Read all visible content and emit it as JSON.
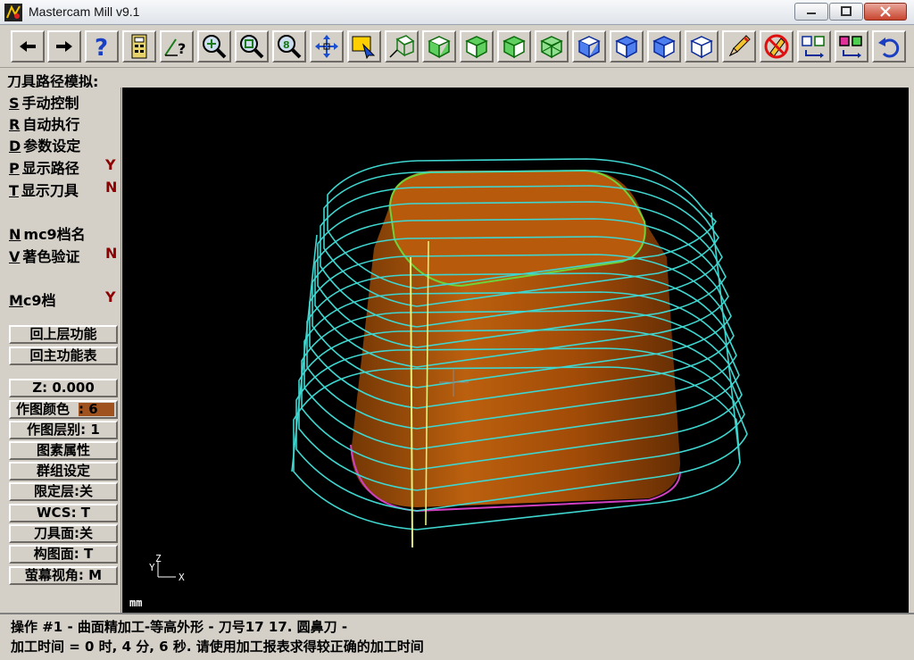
{
  "window": {
    "title": "Mastercam Mill v9.1",
    "minimize_icon": "minimize-icon",
    "maximize_icon": "maximize-icon",
    "close_icon": "close-icon"
  },
  "toolbar": {
    "buttons": [
      {
        "name": "back-arrow-icon"
      },
      {
        "name": "forward-arrow-icon"
      },
      {
        "name": "help-icon"
      },
      {
        "name": "calculator-icon"
      },
      {
        "name": "analyze-icon"
      },
      {
        "name": "zoom-in-icon"
      },
      {
        "name": "zoom-fit-icon"
      },
      {
        "name": "zoom-previous-icon"
      },
      {
        "name": "pan-icon"
      },
      {
        "name": "select-icon"
      },
      {
        "name": "gview-icon"
      },
      {
        "name": "cube-top-icon"
      },
      {
        "name": "cube-front-icon"
      },
      {
        "name": "cube-side-icon"
      },
      {
        "name": "cube-iso-icon"
      },
      {
        "name": "cplane-top-icon"
      },
      {
        "name": "cplane-front-icon"
      },
      {
        "name": "cplane-side-icon"
      },
      {
        "name": "cplane-3d-icon"
      },
      {
        "name": "pencil-icon"
      },
      {
        "name": "delete-icon"
      },
      {
        "name": "screen-fit-icon"
      },
      {
        "name": "layers-icon"
      },
      {
        "name": "undo-icon"
      }
    ]
  },
  "prompt": "刀具路径模拟:",
  "menu": {
    "items": [
      {
        "key": "S",
        "label": "手动控制",
        "flag": ""
      },
      {
        "key": "R",
        "label": "自动执行",
        "flag": ""
      },
      {
        "key": "D",
        "label": "参数设定",
        "flag": ""
      },
      {
        "key": "P",
        "label": "显示路径",
        "flag": "Y"
      },
      {
        "key": "T",
        "label": "显示刀具",
        "flag": "N"
      },
      {
        "key": "N",
        "label": "mc9档名",
        "flag": ""
      },
      {
        "key": "V",
        "label": "著色验证",
        "flag": "N"
      },
      {
        "key": "M",
        "label": "c9档",
        "flag": "Y"
      }
    ],
    "back_upper": "回上层功能",
    "back_main": "回主功能表"
  },
  "side_status": {
    "z": "Z:  0.000",
    "color_label": "作图颜色",
    "color_value": ": 6",
    "layer": "作图层别: 1",
    "attributes": "图素属性",
    "groups": "群组设定",
    "limit_layer": "限定层:关",
    "wcs": "WCS:  T",
    "tplane": "刀具面:关",
    "cplane": "构图面: T",
    "gview": "萤幕视角: M"
  },
  "viewport": {
    "units": "mm",
    "axis_y": "Y",
    "axis_z": "Z",
    "axis_x": "X"
  },
  "status": {
    "line1": "操作 #1 - 曲面精加工-等高外形 - 刀号17 17. 圆鼻刀 -",
    "line2": "加工时间 = 0 时, 4 分, 6 秒. 请使用加工报表求得较正确的加工时间"
  },
  "colors": {
    "background": "#d4d0c8",
    "viewport": "#000000",
    "part": "#b55a0d",
    "toolpath": "#3fd6d0",
    "accent_red": "#8b0000"
  }
}
